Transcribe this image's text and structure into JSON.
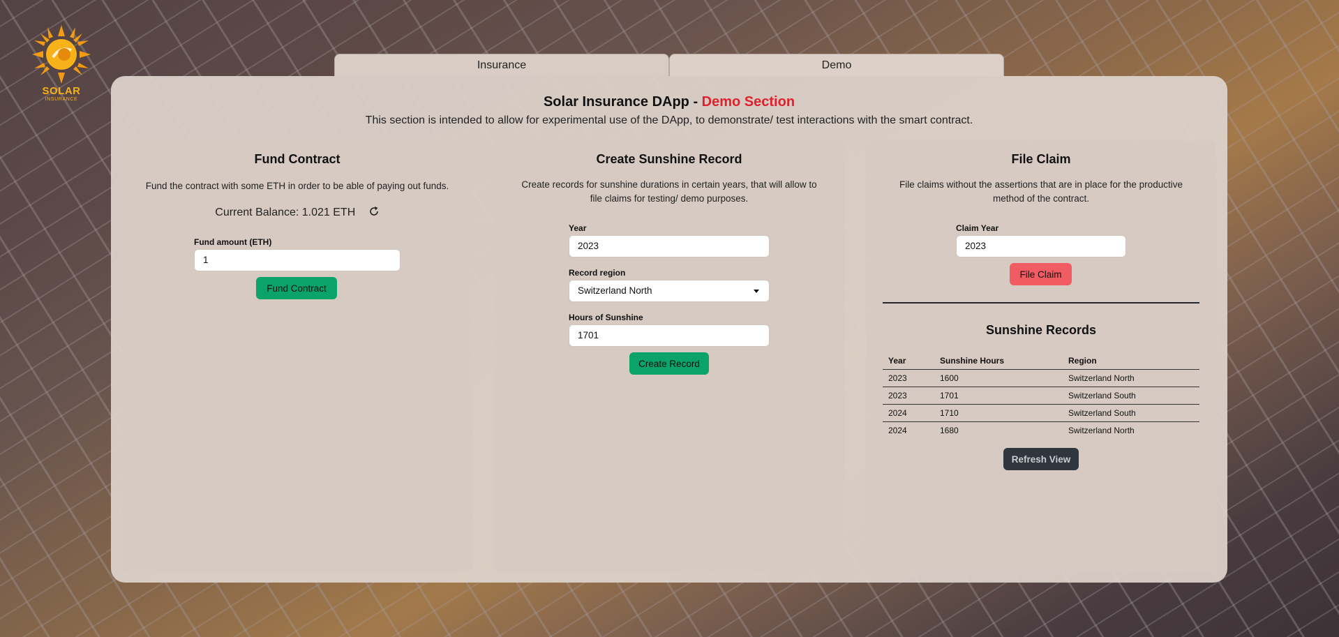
{
  "logo": {
    "word": "SOLAR",
    "sub": "INSURANCE"
  },
  "tabs": [
    {
      "label": "Insurance"
    },
    {
      "label": "Demo"
    }
  ],
  "header": {
    "title_prefix": "Solar Insurance DApp - ",
    "title_accent": "Demo Section",
    "subtitle": "This section is intended to allow for experimental use of the DApp, to demonstrate/ test interactions with the smart contract."
  },
  "fund": {
    "title": "Fund Contract",
    "description": "Fund the contract with some ETH in order to be able of paying out funds.",
    "balance_text": "Current Balance: 1.021 ETH",
    "amount_label": "Fund amount (ETH)",
    "amount_value": "1",
    "button_label": "Fund Contract"
  },
  "sunshine": {
    "title": "Create Sunshine Record",
    "description": "Create records for sunshine durations in certain years, that will allow to file claims for testing/ demo purposes.",
    "year_label": "Year",
    "year_value": "2023",
    "region_label": "Record region",
    "region_value": "Switzerland North",
    "hours_label": "Hours of Sunshine",
    "hours_value": "1701",
    "button_label": "Create Record"
  },
  "claim": {
    "title": "File Claim",
    "description": "File claims without the assertions that are in place for the productive method of the contract.",
    "year_label": "Claim Year",
    "year_value": "2023",
    "button_label": "File Claim"
  },
  "records": {
    "title": "Sunshine Records",
    "columns": [
      "Year",
      "Sunshine Hours",
      "Region"
    ],
    "rows": [
      [
        "2023",
        "1600",
        "Switzerland North"
      ],
      [
        "2023",
        "1701",
        "Switzerland South"
      ],
      [
        "2024",
        "1710",
        "Switzerland South"
      ],
      [
        "2024",
        "1680",
        "Switzerland North"
      ]
    ],
    "refresh_label": "Refresh View"
  },
  "colors": {
    "accent": "#e0212d",
    "primary": "#0aa36a",
    "danger": "#f15b62",
    "dark": "#2f363d",
    "brand": "#f7b21a"
  }
}
